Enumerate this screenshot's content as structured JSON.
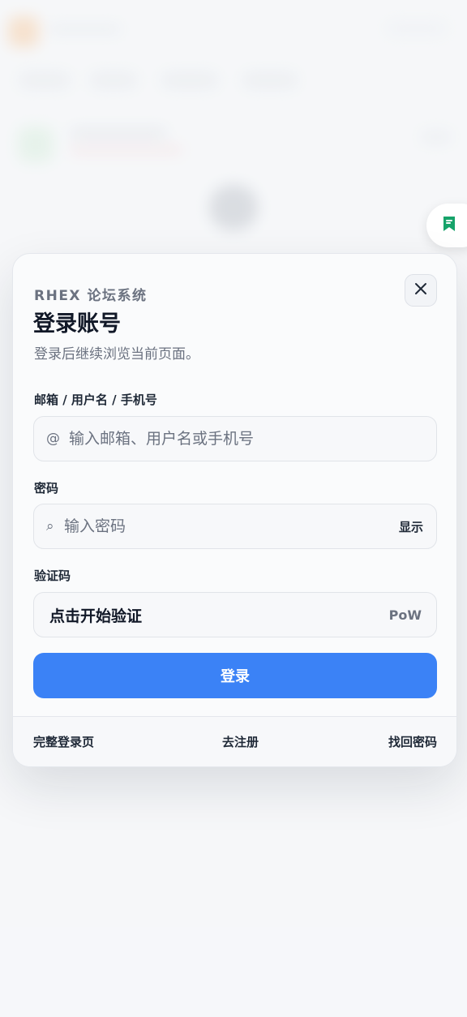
{
  "dialog": {
    "brand": "RHEX 论坛系统",
    "title": "登录账号",
    "subtitle": "登录后继续浏览当前页面。",
    "close_icon": "close-icon"
  },
  "form": {
    "account": {
      "label": "邮箱 / 用户名 / 手机号",
      "prefix": "@",
      "placeholder": "输入邮箱、用户名或手机号",
      "value": ""
    },
    "password": {
      "label": "密码",
      "prefix": "⌕",
      "placeholder": "输入密码",
      "value": "",
      "toggle_label": "显示"
    },
    "captcha": {
      "label": "验证码",
      "text": "点击开始验证",
      "badge": "PoW"
    },
    "submit_label": "登录"
  },
  "footer": {
    "full_login": "完整登录页",
    "register": "去注册",
    "recover": "找回密码"
  },
  "floating": {
    "bookmark_icon": "bookmark-icon",
    "accent": "#16a36a"
  },
  "colors": {
    "primary": "#3b82f6",
    "text": "#111827",
    "muted": "#6b7280"
  }
}
